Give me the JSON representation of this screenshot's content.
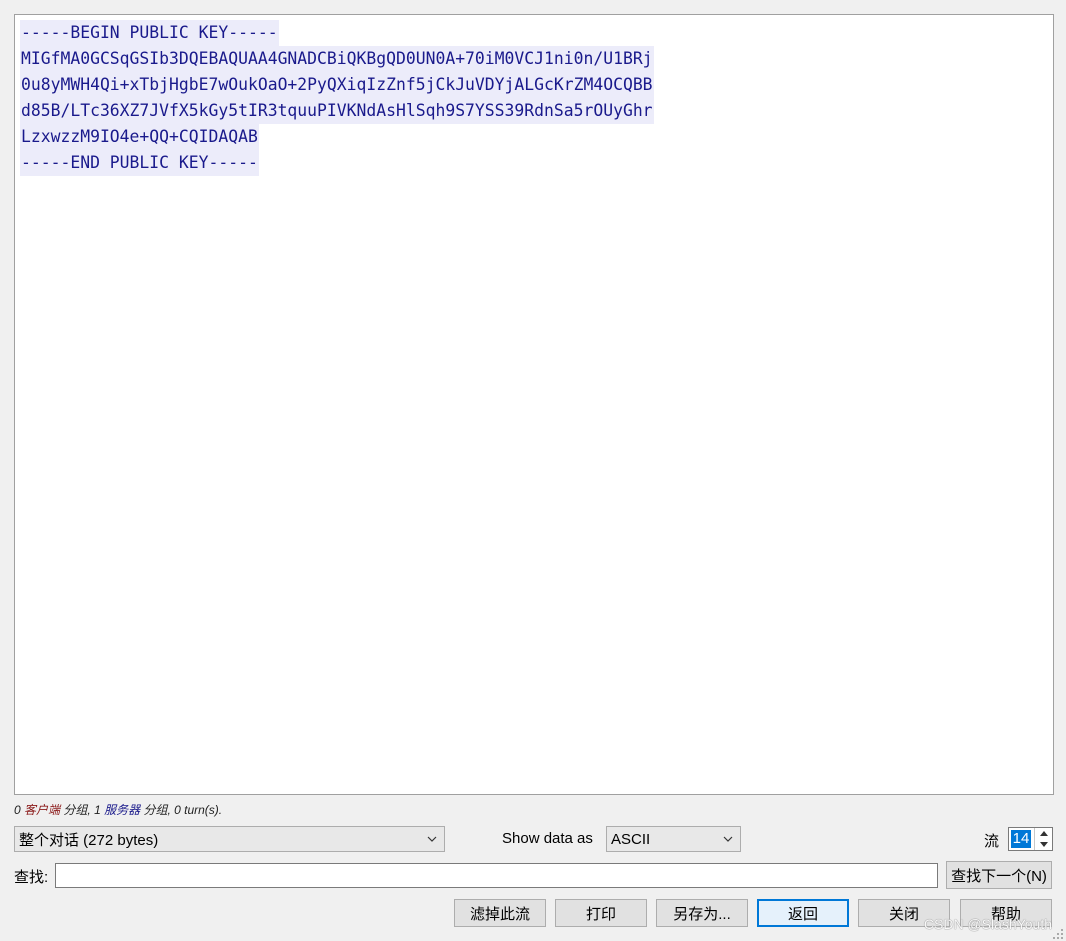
{
  "stream": {
    "lines": [
      "-----BEGIN PUBLIC KEY-----",
      "MIGfMA0GCSqGSIb3DQEBAQUAA4GNADCBiQKBgQD0UN0A+70iM0VCJ1ni0n/U1BRj",
      "0u8yMWH4Qi+xTbjHgbE7wOukOaO+2PyQXiqIzZnf5jCkJuVDYjALGcKrZM4OCQBB",
      "d85B/LTc36XZ7JVfX5kGy5tIR3tquuPIVKNdAsHlSqh9S7YSS39RdnSa5rOUyGhr",
      "LzxwzzM9IO4e+QQ+CQIDAQAB",
      "-----END PUBLIC KEY-----"
    ]
  },
  "summary": {
    "client_count": "0",
    "client_label": "客户端",
    "client_suffix": " 分组, ",
    "server_count": "1",
    "server_label": "服务器",
    "server_suffix": " 分组, 0 turn(s)."
  },
  "conversation_select": {
    "value": "整个对话 (272 bytes)"
  },
  "show_data": {
    "label": "Show data as",
    "value": "ASCII"
  },
  "stream_index": {
    "label": "流",
    "value": "14"
  },
  "find": {
    "label": "查找:",
    "value": "",
    "next_button": "查找下一个(N)"
  },
  "buttons": {
    "filter_out": "滤掉此流",
    "print": "打印",
    "save_as": "另存为...",
    "back": "返回",
    "close": "关闭",
    "help": "帮助"
  },
  "watermark": "CSDN @SlashYouth",
  "icons": {
    "dropdown": "chevron-down-icon",
    "spin_up": "arrow-up-icon",
    "spin_down": "arrow-down-icon",
    "resize": "resize-grip-icon"
  },
  "colors": {
    "stream_text": "#1a1a8c",
    "stream_highlight": "#ececfa",
    "client": "#8b1a1a",
    "server": "#1a1a8b",
    "accent": "#0078d7"
  }
}
